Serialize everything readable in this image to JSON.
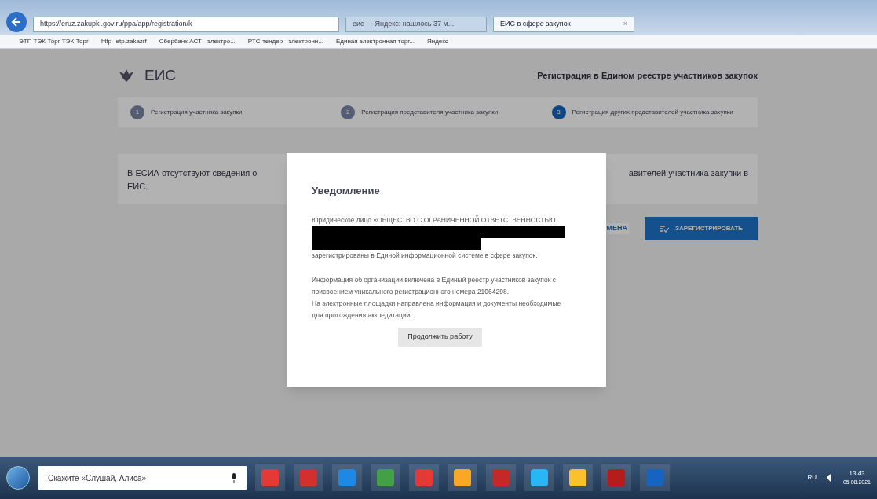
{
  "browser": {
    "address": "https://eruz.zakupki.gov.ru/ppa/app/registration/k",
    "tabs": [
      {
        "label": "еис — Яндекс: нашлось 37 м...",
        "selected": false
      },
      {
        "label": "ЕИС в сфере закупок",
        "selected": true,
        "close": "×"
      }
    ],
    "bookmarks": [
      "ЭТП ТЭК-Торг ТЭК-Торг",
      "http--etp.zakazrf",
      "Сбербанк-АСТ - электро...",
      "РТС-тендер - электронн...",
      "Единая электронная торг...",
      "Яндекс"
    ]
  },
  "header": {
    "logo": "ЕИС",
    "title": "Регистрация в Едином реестре участников закупок"
  },
  "steps": [
    {
      "number": "1",
      "label": "Регистрация участника закупки",
      "selected": false
    },
    {
      "number": "2",
      "label": "Регистрация представителя участника закупки",
      "selected": false
    },
    {
      "number": "3",
      "label": "Регистрация других представителей участника закупки",
      "selected": true
    }
  ],
  "notice": {
    "left_line1": "В ЕСИА отсутствуют сведения о",
    "left_line2": "ЕИС.",
    "right": "авителей участника закупки в"
  },
  "actions": {
    "cancel": "МЕНА",
    "register": "ЗАРЕГИСТРИРОВАТЬ"
  },
  "modal": {
    "title": "Уведомление",
    "paragraph1_start": "Юридическое лицо «ОБЩЕСТВО С ОГРАНИЧЕННОЙ ОТВЕТСТВЕННОСТЬЮ",
    "paragraph1_end": "зарегистрированы в Единой информационной системе в сфере закупок.",
    "paragraph2": "Информация об организации включена в Единый реестр участников закупок с присвоением уникального регистрационного номера 21064298.",
    "paragraph3": "На электронные площадки направлена информация и документы необходимые для прохождения аккредитации.",
    "button": "Продолжить работу"
  },
  "taskbar": {
    "search": "Скажите «Слушай, Алиса»",
    "lang": "RU",
    "time": "13:43",
    "date": "05.08.2021"
  }
}
